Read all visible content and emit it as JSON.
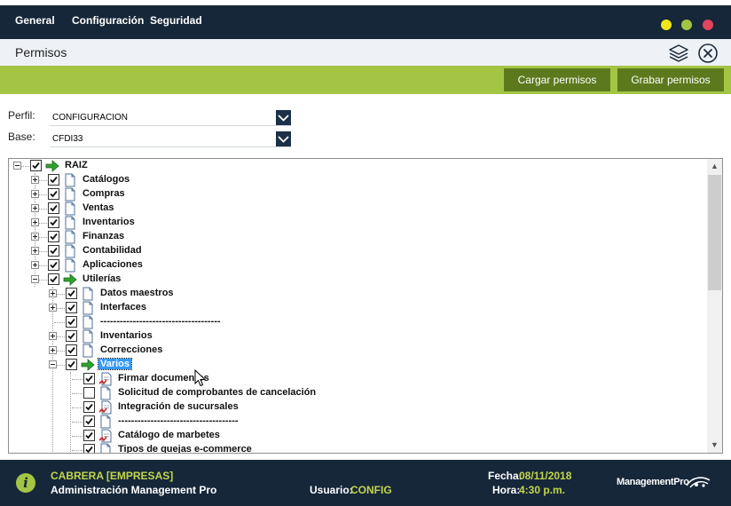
{
  "menu": {
    "items": [
      "General",
      "Configuración",
      "Seguridad"
    ]
  },
  "window": {
    "title": "Permisos",
    "controls": [
      "minimize-button-yellow",
      "maximize-button-green",
      "close-button-red"
    ],
    "colors": {
      "yellow": "#f0e619",
      "green": "#a4c544",
      "red": "#e2445c"
    }
  },
  "toolbar": {
    "load_label": "Cargar permisos",
    "save_label": "Grabar permisos"
  },
  "form": {
    "profile_label": "Perfil:",
    "profile_value": "CONFIGURACION",
    "base_label": "Base:",
    "base_value": "CFDI33"
  },
  "tree": {
    "nodes": [
      {
        "label": "RAIZ",
        "level": 0,
        "expander": "minus",
        "checked": true,
        "icon": "green-arrow-icon"
      },
      {
        "label": "Catálogos",
        "level": 1,
        "expander": "plus",
        "checked": true,
        "icon": "document-icon"
      },
      {
        "label": "Compras",
        "level": 1,
        "expander": "plus",
        "checked": true,
        "icon": "document-icon"
      },
      {
        "label": "Ventas",
        "level": 1,
        "expander": "plus",
        "checked": true,
        "icon": "document-icon"
      },
      {
        "label": "Inventarios",
        "level": 1,
        "expander": "plus",
        "checked": true,
        "icon": "document-icon"
      },
      {
        "label": "Finanzas",
        "level": 1,
        "expander": "plus",
        "checked": true,
        "icon": "document-icon"
      },
      {
        "label": "Contabilidad",
        "level": 1,
        "expander": "plus",
        "checked": true,
        "icon": "document-icon"
      },
      {
        "label": "Aplicaciones",
        "level": 1,
        "expander": "plus",
        "checked": true,
        "icon": "document-icon"
      },
      {
        "label": "Utilerías",
        "level": 1,
        "expander": "minus",
        "checked": true,
        "icon": "green-arrow-icon"
      },
      {
        "label": "Datos maestros",
        "level": 2,
        "expander": "plus",
        "checked": true,
        "icon": "document-icon"
      },
      {
        "label": "Interfaces",
        "level": 2,
        "expander": "plus",
        "checked": true,
        "icon": "document-icon"
      },
      {
        "label": "-------------------------------------",
        "level": 2,
        "expander": "none",
        "checked": true,
        "icon": "document-icon"
      },
      {
        "label": "Inventarios",
        "level": 2,
        "expander": "plus",
        "checked": true,
        "icon": "document-icon"
      },
      {
        "label": "Correcciones",
        "level": 2,
        "expander": "plus",
        "checked": true,
        "icon": "document-icon"
      },
      {
        "label": "Varios",
        "level": 2,
        "expander": "minus",
        "checked": true,
        "icon": "green-arrow-icon",
        "selected": true
      },
      {
        "label": "Firmar documentos",
        "level": 3,
        "expander": "none",
        "checked": true,
        "icon": "signed-document-icon"
      },
      {
        "label": "Solicitud de comprobantes de cancelación",
        "level": 3,
        "expander": "none",
        "checked": false,
        "icon": "document-icon"
      },
      {
        "label": "Integración de sucursales",
        "level": 3,
        "expander": "none",
        "checked": true,
        "icon": "signed-document-icon"
      },
      {
        "label": "-------------------------------------",
        "level": 3,
        "expander": "none",
        "checked": true,
        "icon": "document-icon"
      },
      {
        "label": "Catálogo de marbetes",
        "level": 3,
        "expander": "none",
        "checked": true,
        "icon": "signed-document-icon"
      },
      {
        "label": "Tipos de quejas e-commerce",
        "level": 3,
        "expander": "none",
        "checked": true,
        "icon": "document-icon"
      }
    ]
  },
  "status": {
    "company": "CABRERA [EMPRESAS]",
    "app_name": "Administración Management Pro",
    "user_label": "Usuario:",
    "user_value": "CONFIG",
    "date_label": "Fecha:",
    "date_value": "08/11/2018",
    "time_label": "Hora:",
    "time_value": "4:30 p.m.",
    "brand": "ManagementPro"
  }
}
